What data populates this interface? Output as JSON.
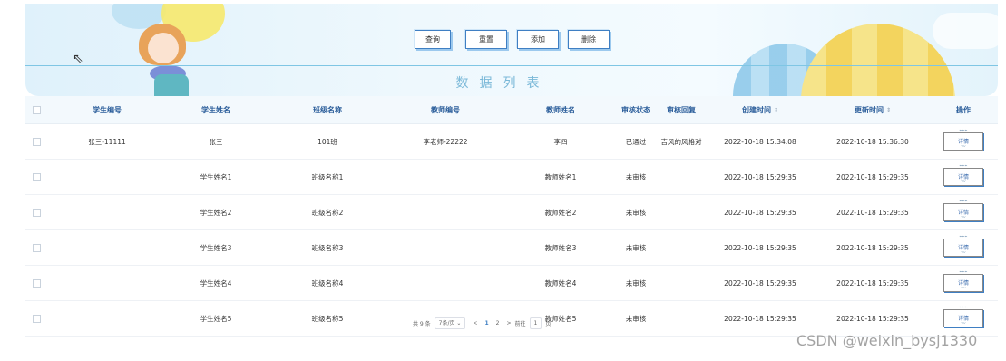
{
  "toolbar": {
    "query_label": "查询",
    "reset_label": "重置",
    "add_label": "添加",
    "delete_label": "删除"
  },
  "list_title": "数据列表",
  "columns": {
    "student_no": "学生编号",
    "student_name": "学生姓名",
    "class_name": "班级名称",
    "teacher_no": "教师编号",
    "teacher_name": "教师姓名",
    "review_status": "审核状态",
    "review_reply": "审核回复",
    "created_at": "创建时间",
    "updated_at": "更新时间",
    "actions": "操作"
  },
  "sort_icon": "⇕",
  "rows": [
    {
      "student_no": "张三-11111",
      "student_name": "张三",
      "class_name": "101班",
      "teacher_no": "李老师-22222",
      "teacher_name": "李四",
      "review_status": "已通过",
      "review_reply": "吉风的风格对",
      "created_at": "2022-10-18 15:34:08",
      "updated_at": "2022-10-18 15:36:30",
      "detail": "详情"
    },
    {
      "student_no": "",
      "student_name": "学生姓名1",
      "class_name": "班级名称1",
      "teacher_no": "",
      "teacher_name": "教师姓名1",
      "review_status": "未审核",
      "review_reply": "",
      "created_at": "2022-10-18 15:29:35",
      "updated_at": "2022-10-18 15:29:35",
      "detail": "详情"
    },
    {
      "student_no": "",
      "student_name": "学生姓名2",
      "class_name": "班级名称2",
      "teacher_no": "",
      "teacher_name": "教师姓名2",
      "review_status": "未审核",
      "review_reply": "",
      "created_at": "2022-10-18 15:29:35",
      "updated_at": "2022-10-18 15:29:35",
      "detail": "详情"
    },
    {
      "student_no": "",
      "student_name": "学生姓名3",
      "class_name": "班级名称3",
      "teacher_no": "",
      "teacher_name": "教师姓名3",
      "review_status": "未审核",
      "review_reply": "",
      "created_at": "2022-10-18 15:29:35",
      "updated_at": "2022-10-18 15:29:35",
      "detail": "详情"
    },
    {
      "student_no": "",
      "student_name": "学生姓名4",
      "class_name": "班级名称4",
      "teacher_no": "",
      "teacher_name": "教师姓名4",
      "review_status": "未审核",
      "review_reply": "",
      "created_at": "2022-10-18 15:29:35",
      "updated_at": "2022-10-18 15:29:35",
      "detail": "详情"
    },
    {
      "student_no": "",
      "student_name": "学生姓名5",
      "class_name": "班级名称5",
      "teacher_no": "",
      "teacher_name": "教师姓名5",
      "review_status": "未审核",
      "review_reply": "",
      "created_at": "2022-10-18 15:29:35",
      "updated_at": "2022-10-18 15:29:35",
      "detail": "详情"
    }
  ],
  "pagination": {
    "total": "共 9 条",
    "page_size": "7条/页",
    "prev": "<",
    "pages": [
      "1",
      "2"
    ],
    "next": ">",
    "goto_label": "前往",
    "goto_value": "1",
    "page_suffix": "页"
  },
  "watermark": "CSDN @weixin_bysj1330"
}
